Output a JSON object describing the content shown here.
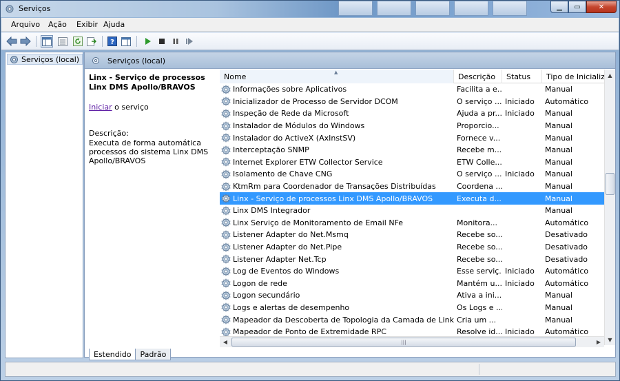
{
  "window": {
    "title": "Serviços"
  },
  "menu": [
    "Arquivo",
    "Ação",
    "Exibir",
    "Ajuda"
  ],
  "tree": {
    "root_label": "Serviços (local)"
  },
  "pane": {
    "header": "Serviços (local)"
  },
  "details": {
    "service_name": "Linx - Serviço de processos Linx DMS Apollo/BRAVOS",
    "start_link": "Iniciar",
    "start_suffix": " o serviço",
    "description_label": "Descrição:",
    "description_text": "Executa de forma automática processos do sistema Linx DMS Apollo/BRAVOS"
  },
  "columns": {
    "name": "Nome",
    "description": "Descrição",
    "status": "Status",
    "startup": "Tipo de Inicializa"
  },
  "services": [
    {
      "name": "Informações sobre Aplicativos",
      "description": "Facilita a e...",
      "status": "",
      "startup": "Manual"
    },
    {
      "name": "Inicializador de Processo de Servidor DCOM",
      "description": "O serviço ...",
      "status": "Iniciado",
      "startup": "Automático"
    },
    {
      "name": "Inspeção de Rede da Microsoft",
      "description": "Ajuda a pr...",
      "status": "Iniciado",
      "startup": "Manual"
    },
    {
      "name": "Instalador de Módulos do Windows",
      "description": "Proporcio...",
      "status": "",
      "startup": "Manual"
    },
    {
      "name": "Instalador do ActiveX (AxInstSV)",
      "description": "Fornece v...",
      "status": "",
      "startup": "Manual"
    },
    {
      "name": "Interceptação SNMP",
      "description": "Recebe m...",
      "status": "",
      "startup": "Manual"
    },
    {
      "name": "Internet Explorer ETW Collector Service",
      "description": "ETW Colle...",
      "status": "",
      "startup": "Manual"
    },
    {
      "name": "Isolamento de Chave CNG",
      "description": "O serviço ...",
      "status": "Iniciado",
      "startup": "Manual"
    },
    {
      "name": "KtmRm para Coordenador de Transações Distribuídas",
      "description": "Coordena ...",
      "status": "",
      "startup": "Manual"
    },
    {
      "name": "Linx - Serviço de processos Linx DMS Apollo/BRAVOS",
      "description": "Executa d...",
      "status": "",
      "startup": "Manual",
      "selected": true
    },
    {
      "name": "Linx DMS Integrador",
      "description": "",
      "status": "",
      "startup": "Manual"
    },
    {
      "name": "Linx Serviço de Monitoramento de Email NFe",
      "description": "Monitora...",
      "status": "",
      "startup": "Automático"
    },
    {
      "name": "Listener Adapter do Net.Msmq",
      "description": "Recebe so...",
      "status": "",
      "startup": "Desativado"
    },
    {
      "name": "Listener Adapter do Net.Pipe",
      "description": "Recebe so...",
      "status": "",
      "startup": "Desativado"
    },
    {
      "name": "Listener Adapter Net.Tcp",
      "description": "Recebe so...",
      "status": "",
      "startup": "Desativado"
    },
    {
      "name": "Log de Eventos do Windows",
      "description": "Esse serviç...",
      "status": "Iniciado",
      "startup": "Automático"
    },
    {
      "name": "Logon de rede",
      "description": "Mantém u...",
      "status": "Iniciado",
      "startup": "Automático"
    },
    {
      "name": "Logon secundário",
      "description": "Ativa a ini...",
      "status": "",
      "startup": "Manual"
    },
    {
      "name": "Logs e alertas de desempenho",
      "description": "Os Logs e ...",
      "status": "",
      "startup": "Manual"
    },
    {
      "name": "Mapeador da Descoberta de Topologia da Camada de Link",
      "description": "Cria um ...",
      "status": "",
      "startup": "Manual"
    },
    {
      "name": "Mapeador de Ponto de Extremidade RPC",
      "description": "Resolve id...",
      "status": "Iniciado",
      "startup": "Automático"
    }
  ],
  "tabs": [
    "Estendido",
    "Padrão"
  ],
  "colors": {
    "selection": "#3399ff",
    "link": "#5b19a3"
  }
}
